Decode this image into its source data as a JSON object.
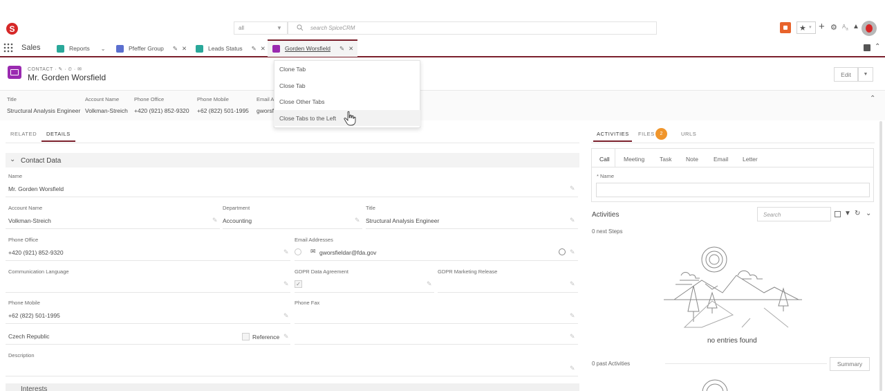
{
  "topbar": {
    "logo": "S",
    "scope_value": "all",
    "search_placeholder": "search SpiceCRM"
  },
  "tabbar": {
    "app_name": "Sales",
    "tabs": [
      {
        "label": "Reports"
      },
      {
        "label": "Pfeffer Group"
      },
      {
        "label": "Leads Status"
      },
      {
        "label": "Gorden Worsfield"
      }
    ]
  },
  "context_menu": {
    "items": [
      "Clone Tab",
      "Close Tab",
      "Close Other Tabs",
      "Close Tabs to the Left"
    ]
  },
  "record": {
    "module": "CONTACT",
    "title": "Mr. Gorden Worsfield",
    "edit_label": "Edit",
    "summary": {
      "labels": [
        "Title",
        "Account Name",
        "Phone Office",
        "Phone Mobile",
        "Email A"
      ],
      "values": [
        "Structural Analysis Engineer",
        "Volkman-Streich",
        "+420 (921) 852-9320",
        "+62 (822) 501-1995",
        "gworsf"
      ]
    }
  },
  "left_tabs": {
    "related": "RELATED",
    "details": "DETAILS"
  },
  "contact_data": {
    "section_title": "Contact Data",
    "name_label": "Name",
    "name": "Mr. Gorden Worsfield",
    "account_label": "Account Name",
    "account": "Volkman-Streich",
    "department_label": "Department",
    "department": "Accounting",
    "title_label": "Title",
    "title": "Structural Analysis Engineer",
    "phone_office_label": "Phone Office",
    "phone_office": "+420 (921) 852-9320",
    "email_label": "Email Addresses",
    "email": "gworsfieldar@fda.gov",
    "comm_lang_label": "Communication Language",
    "gdpr_data_label": "GDPR Data Agreement",
    "gdpr_marketing_label": "GDPR Marketing Release",
    "phone_mobile_label": "Phone Mobile",
    "phone_mobile": "+62 (822) 501-1995",
    "phone_fax_label": "Phone Fax",
    "country": "Czech Republic",
    "reference_label": "Reference",
    "description_label": "Description",
    "next_section": "Interests"
  },
  "right_panel": {
    "tabs": {
      "activities": "ACTIVITIES",
      "files": "FILES",
      "files_count": "2",
      "urls": "URLS"
    },
    "activity_types": [
      "Call",
      "Meeting",
      "Task",
      "Note",
      "Email",
      "Letter"
    ],
    "name_label": "* Name",
    "activities_title": "Activities",
    "search_placeholder": "Search",
    "next_steps": "0 next Steps",
    "no_entries": "no entries found",
    "past_activities": "0 past Activities",
    "summary_button": "Summary"
  }
}
